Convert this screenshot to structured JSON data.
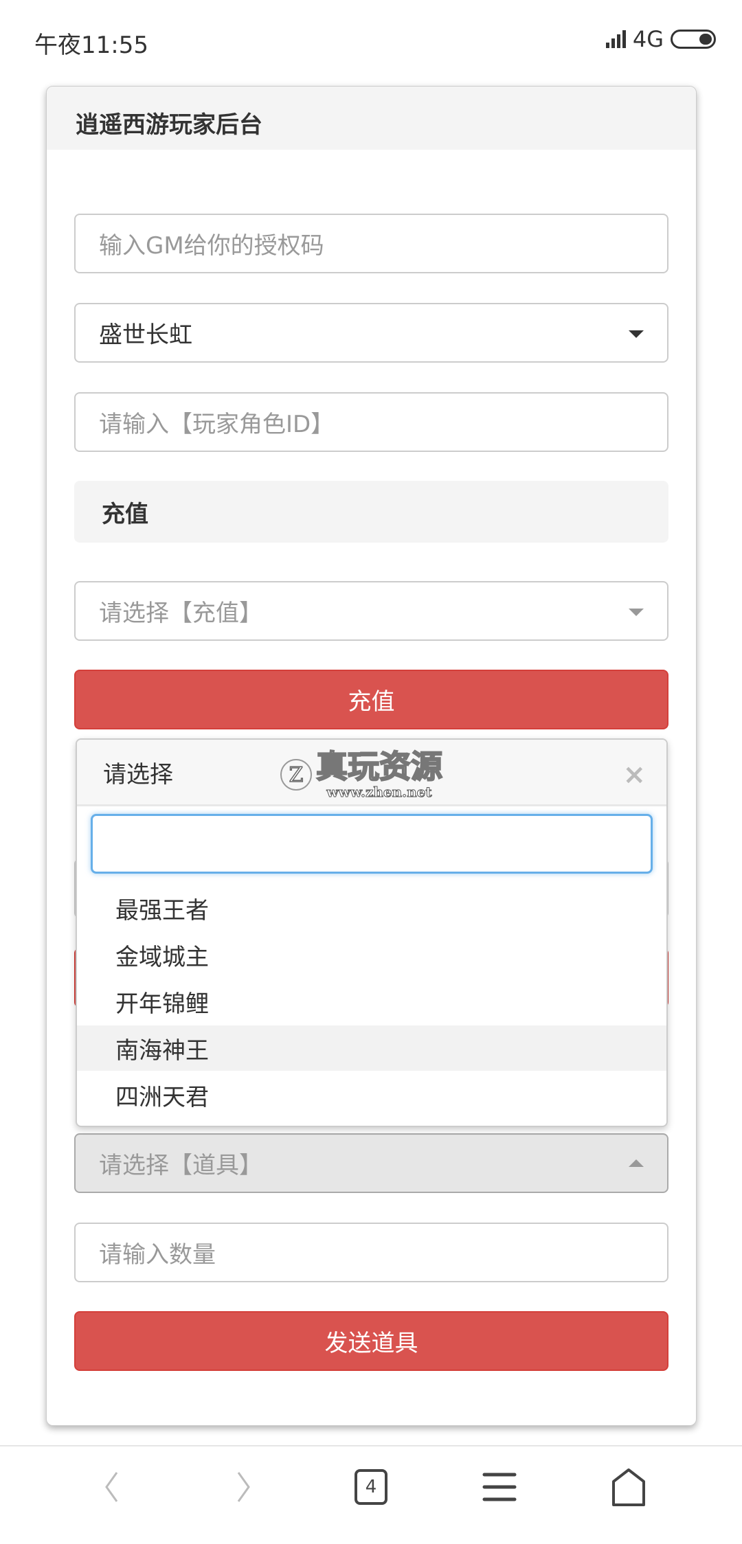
{
  "status_bar": {
    "time": "午夜11:55",
    "network": "4G"
  },
  "card": {
    "title": "逍遥西游玩家后台"
  },
  "form": {
    "auth_placeholder": "输入GM给你的授权码",
    "server_value": "盛世长虹",
    "role_placeholder": "请输入【玩家角色ID】",
    "recharge_section": "充值",
    "recharge_placeholder": "请选择【充值】",
    "recharge_button": "充值",
    "item_placeholder": "请选择【道具】",
    "quantity_placeholder": "请输入数量",
    "send_button": "发送道具"
  },
  "dropdown": {
    "title": "请选择",
    "close": "×",
    "search_value": "",
    "options": [
      "最强王者",
      "金域城主",
      "开年锦鲤",
      "南海神王",
      "四洲天君"
    ],
    "highlighted": "南海神王"
  },
  "watermark": {
    "logo": "Z",
    "text": "真玩资源",
    "url": "www.zhen.net"
  },
  "bottom_nav": {
    "tabs_count": "4",
    "icons": [
      "back-icon",
      "forward-icon",
      "tabs-icon",
      "menu-icon",
      "home-icon"
    ]
  },
  "colors": {
    "primary_button": "#d9534f",
    "focus": "#66afe9"
  }
}
